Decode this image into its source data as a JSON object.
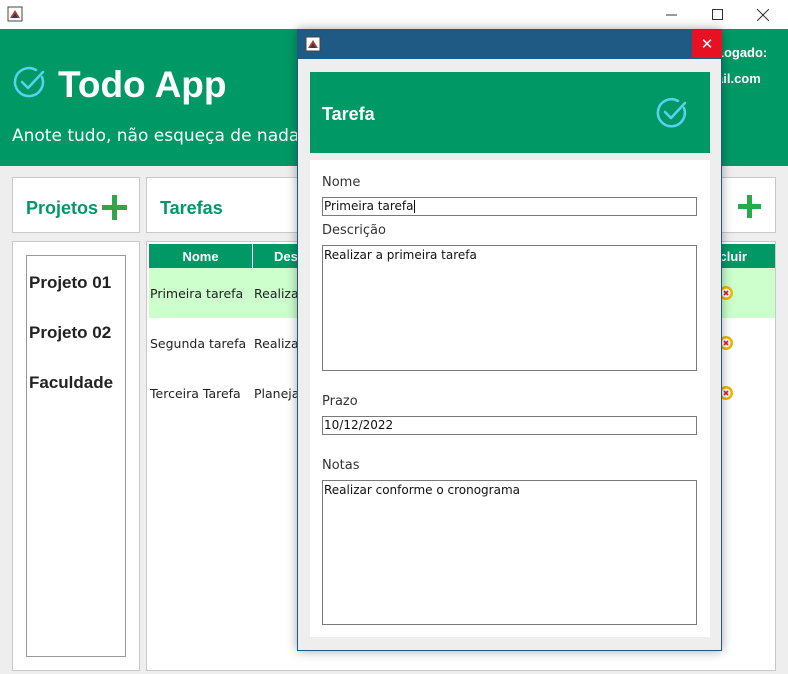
{
  "header": {
    "title": "Todo App",
    "subtitle": "Anote tudo, não esqueça de nada",
    "logged_label": "Logado:",
    "logged_email": "ail.com"
  },
  "projects": {
    "title": "Projetos",
    "items": [
      "Projeto 01",
      "Projeto 02",
      "Faculdade"
    ]
  },
  "tasks": {
    "title": "Tarefas",
    "columns": [
      "Nome",
      "Des",
      "cluir"
    ],
    "rows": [
      {
        "name": "Primeira tarefa",
        "desc": "Realizar"
      },
      {
        "name": "Segunda tarefa",
        "desc": "Realizar"
      },
      {
        "name": "Terceira Tarefa",
        "desc": "Planeja"
      }
    ]
  },
  "dialog": {
    "title": "Tarefa",
    "close": "✕",
    "name_label": "Nome",
    "name_value": "Primeira tarefa",
    "desc_label": "Descrição",
    "desc_value": "Realizar a primeira tarefa",
    "deadline_label": "Prazo",
    "deadline_value": "10/12/2022",
    "notes_label": "Notas",
    "notes_value": "Realizar conforme o cronograma"
  },
  "icons": {
    "check": "check-circle-icon",
    "add": "plus-icon",
    "delete": "delete-icon"
  },
  "colors": {
    "brand": "#009966",
    "dialog_bar": "#1f5a85",
    "close": "#e81123",
    "selected_row": "#ccffcc"
  }
}
